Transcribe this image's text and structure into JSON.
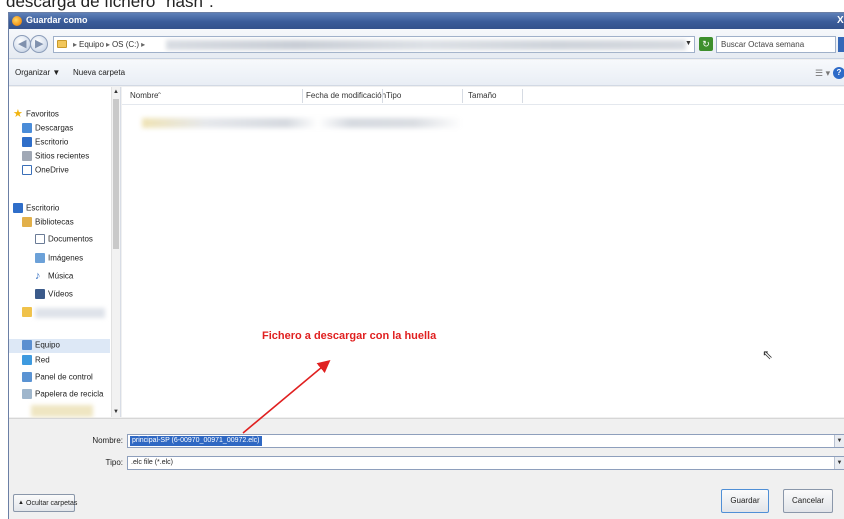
{
  "caption": "descarga de fichero \"hash\".",
  "window": {
    "title": "Guardar como"
  },
  "address": {
    "crumbs": [
      "Equipo",
      "OS (C:)"
    ],
    "search_placeholder": "Buscar Octava semana"
  },
  "toolbar": {
    "organize": "Organizar ▼",
    "new_folder": "Nueva carpeta"
  },
  "nav": {
    "items": [
      {
        "label": "Favoritos",
        "icon": "star-icon"
      },
      {
        "label": "Descargas",
        "icon": "downloads-folder-icon"
      },
      {
        "label": "Escritorio",
        "icon": "desktop-icon"
      },
      {
        "label": "Sitios recientes",
        "icon": "recent-places-icon"
      },
      {
        "label": "OneDrive",
        "icon": "onedrive-icon"
      },
      {
        "label": "Escritorio",
        "icon": "desktop-icon"
      },
      {
        "label": "Bibliotecas",
        "icon": "libraries-icon"
      },
      {
        "label": "Documentos",
        "icon": "documents-icon"
      },
      {
        "label": "Imágenes",
        "icon": "pictures-icon"
      },
      {
        "label": "Música",
        "icon": "music-icon"
      },
      {
        "label": "Vídeos",
        "icon": "videos-icon"
      },
      {
        "label": "Equipo",
        "icon": "computer-icon"
      },
      {
        "label": "Red",
        "icon": "network-icon"
      },
      {
        "label": "Panel de control",
        "icon": "control-panel-icon"
      },
      {
        "label": "Papelera de recicla",
        "icon": "recycle-bin-icon"
      }
    ]
  },
  "columns": {
    "name": "Nombre",
    "modified": "Fecha de modificación",
    "type": "Tipo",
    "size": "Tamaño"
  },
  "annotation": "Fichero a descargar con la huella",
  "fields": {
    "name_label": "Nombre:",
    "name_value": "principal-SP (6-00970_00971_00972.elc)",
    "type_label": "Tipo:",
    "type_value": ".elc file (*.elc)"
  },
  "buttons": {
    "hide_folders": "Ocultar carpetas",
    "save": "Guardar",
    "cancel": "Cancelar"
  },
  "colors": {
    "titlebar": "#3b5c99",
    "annotation": "#e02020",
    "selection": "#2f68c3"
  }
}
